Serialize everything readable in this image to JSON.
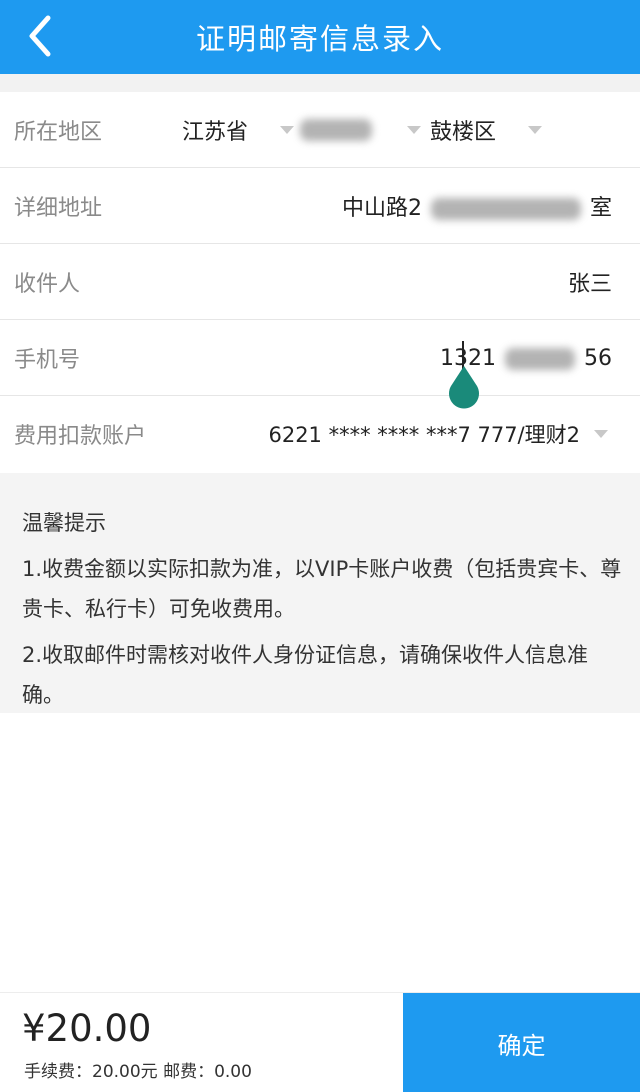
{
  "header": {
    "back_icon": "chevron-left-icon",
    "title": "证明邮寄信息录入"
  },
  "form": {
    "region": {
      "label": "所在地区",
      "province": "江苏省",
      "city": "",
      "district": "鼓楼区"
    },
    "address": {
      "label": "详细地址",
      "value_prefix": "中山路2",
      "value_suffix": "室"
    },
    "recipient": {
      "label": "收件人",
      "value": "张三"
    },
    "phone": {
      "label": "手机号",
      "value_prefix": "1321",
      "value_suffix": "56"
    },
    "account": {
      "label": "费用扣款账户",
      "value": "6221 **** **** ***7 777/理财2"
    }
  },
  "tips": {
    "title": "温馨提示",
    "items": [
      "1.收费金额以实际扣款为准，以VIP卡账户收费（包括贵宾卡、尊贵卡、私行卡）可免收费用。",
      "2.收取邮件时需核对收件人身份证信息，请确保收件人信息准确。"
    ]
  },
  "footer": {
    "amount": "¥20.00",
    "fee_detail": "手续费：20.00元 邮费：0.00",
    "confirm_label": "确定"
  },
  "colors": {
    "primary": "#1e9af0",
    "cursor_handle": "#1a8a7a"
  }
}
